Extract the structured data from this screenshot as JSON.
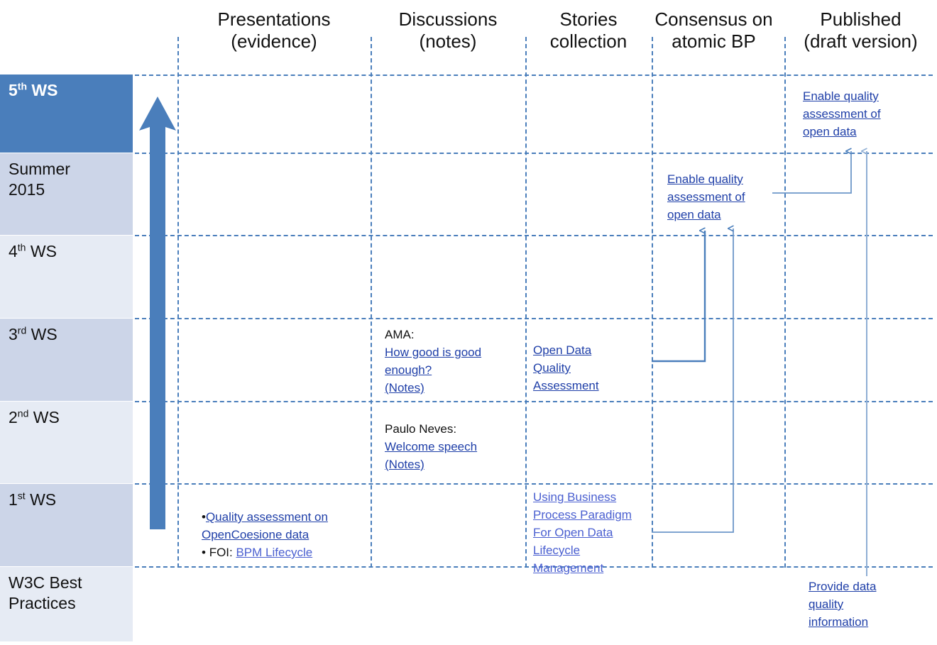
{
  "diagram": {
    "title": "Workshop timeline matrix",
    "accent": "#4a7ebb",
    "link_color": "#1f3fa8",
    "link_color_light": "#4a5fd0"
  },
  "columns": [
    {
      "id": "presentations",
      "line1": "Presentations",
      "line2": "(evidence)"
    },
    {
      "id": "discussions",
      "line1": "Discussions",
      "line2": "(notes)"
    },
    {
      "id": "stories",
      "line1": "Stories",
      "line2": "collection"
    },
    {
      "id": "consensus",
      "line1": "Consensus on",
      "line2": "atomic BP"
    },
    {
      "id": "published",
      "line1": "Published",
      "line2": "(draft version)"
    }
  ],
  "rows": [
    {
      "id": "ws5",
      "label": "5",
      "sup": "th",
      "suffix": " WS",
      "label2": "",
      "style": "sel"
    },
    {
      "id": "summer",
      "label": "Summer",
      "sup": "",
      "suffix": "",
      "label2": "2015",
      "style": "sh-a"
    },
    {
      "id": "ws4",
      "label": "4",
      "sup": "th",
      "suffix": " WS",
      "label2": "",
      "style": "sh-b"
    },
    {
      "id": "ws3",
      "label": "3",
      "sup": "rd",
      "suffix": " WS",
      "label2": "",
      "style": "sh-a"
    },
    {
      "id": "ws2",
      "label": "2",
      "sup": "nd",
      "suffix": " WS",
      "label2": "",
      "style": "sh-b"
    },
    {
      "id": "ws1",
      "label": "1",
      "sup": "st",
      "suffix": " WS",
      "label2": "",
      "style": "sh-a"
    },
    {
      "id": "w3cbp",
      "label": "W3C Best",
      "sup": "",
      "suffix": "",
      "label2": "Practices",
      "style": "sh-b"
    }
  ],
  "cells": {
    "ws1_presentations": {
      "bullet1": "•",
      "link1_line1": "Quality assessment on",
      "link1_line2": "OpenCoesione data",
      "bullet2": "• ",
      "label2": "FOI: ",
      "link2": "BPM Lifecycle"
    },
    "ws2_discussions": {
      "speaker": "Paulo Neves:",
      "link_line1": "Welcome speech",
      "link_line2": "(Notes)"
    },
    "ws3_discussions": {
      "speaker": "AMA:",
      "link_line1": "How good is good",
      "link_line2": "enough?",
      "link_line3": "(Notes)"
    },
    "ws3_stories": {
      "link_line1": "Open Data",
      "link_line2": "Quality",
      "link_line3": "Assessment"
    },
    "ws1_stories": {
      "link_line1": "Using Business",
      "link_line2": "Process Paradigm",
      "link_line3": "For Open Data",
      "link_line4": "Lifecycle",
      "link_line5": "Management"
    },
    "summer_consensus": {
      "link_line1": "Enable quality",
      "link_line2": "assessment of",
      "link_line3": "open data"
    },
    "ws5_published": {
      "link_line1": "Enable quality",
      "link_line2": "assessment of",
      "link_line3": "open data"
    },
    "w3c_published": {
      "link_line1": "Provide data",
      "link_line2": "quality",
      "link_line3": "information"
    }
  },
  "icons": {
    "timeline_arrow": "up-arrow-icon"
  }
}
